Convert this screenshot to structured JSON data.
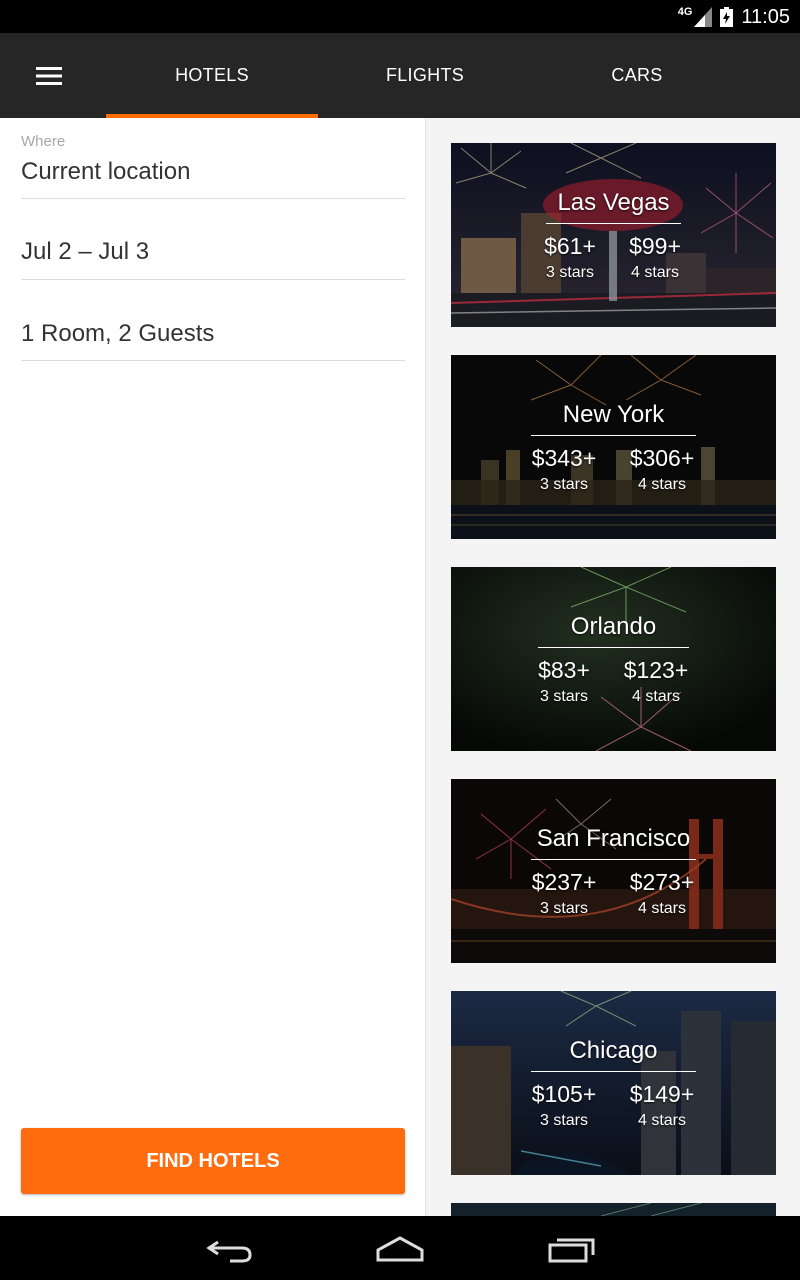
{
  "status_bar": {
    "network": "4G",
    "time": "11:05"
  },
  "tabs": [
    {
      "label": "HOTELS",
      "active": true
    },
    {
      "label": "FLIGHTS",
      "active": false
    },
    {
      "label": "CARS",
      "active": false
    }
  ],
  "form": {
    "where_label": "Where",
    "where_value": "Current location",
    "dates_value": "Jul 2 – Jul 3",
    "guests_value": "1 Room, 2 Guests",
    "submit_label": "FIND HOTELS"
  },
  "deals": [
    {
      "city": "Las Vegas",
      "price3": "$61+",
      "label3": "3 stars",
      "price4": "$99+",
      "label4": "4 stars"
    },
    {
      "city": "New York",
      "price3": "$343+",
      "label3": "3 stars",
      "price4": "$306+",
      "label4": "4 stars"
    },
    {
      "city": "Orlando",
      "price3": "$83+",
      "label3": "3 stars",
      "price4": "$123+",
      "label4": "4 stars"
    },
    {
      "city": "San Francisco",
      "price3": "$237+",
      "label3": "3 stars",
      "price4": "$273+",
      "label4": "4 stars"
    },
    {
      "city": "Chicago",
      "price3": "$105+",
      "label3": "3 stars",
      "price4": "$149+",
      "label4": "4 stars"
    }
  ],
  "colors": {
    "accent": "#ff6c00",
    "appbar": "#262626",
    "button": "#ff6c0f"
  },
  "icons": {
    "menu": "menu-icon",
    "back": "back-icon",
    "home": "home-icon",
    "recents": "recents-icon"
  }
}
